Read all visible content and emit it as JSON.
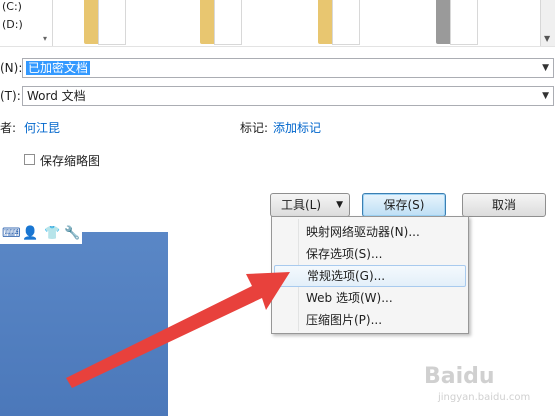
{
  "nav": {
    "drive_c": "(C:)",
    "drive_d": "(D:)"
  },
  "filename": {
    "label": "(N):",
    "value": "已加密文档"
  },
  "filetype": {
    "label": "(T):",
    "value": "Word 文档"
  },
  "meta": {
    "author_label": "者:",
    "author_value": "何江昆",
    "tags_label": "标记:",
    "tags_value": "添加标记"
  },
  "thumbnail": {
    "label": "保存缩略图",
    "checked": false
  },
  "buttons": {
    "tools": "工具(L)",
    "save": "保存(S)",
    "cancel": "取消"
  },
  "tools_menu": {
    "items": [
      {
        "label": "映射网络驱动器(N)..."
      },
      {
        "label": "保存选项(S)..."
      },
      {
        "label": "常规选项(G)..."
      },
      {
        "label": "Web 选项(W)..."
      },
      {
        "label": "压缩图片(P)..."
      }
    ],
    "highlighted_index": 2
  },
  "colors": {
    "accent": "#3399ff",
    "link": "#0066cc",
    "arrow": "#e8413c",
    "panel": "#4f7dbe"
  },
  "watermark": {
    "text": "Baidu",
    "sub": "jingyan.baidu.com"
  }
}
